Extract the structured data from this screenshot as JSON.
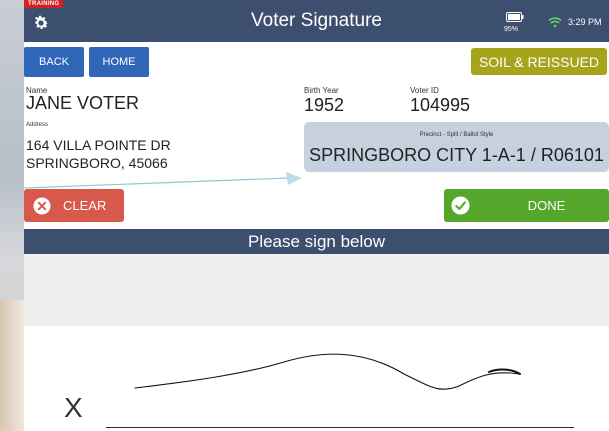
{
  "header": {
    "training_badge": "TRAINING",
    "title": "Voter Signature",
    "battery_percent": "95%",
    "time": "3:29 PM",
    "icons": [
      "gear-icon",
      "battery-icon",
      "wifi-icon"
    ]
  },
  "nav": {
    "back_label": "BACK",
    "home_label": "HOME"
  },
  "status_badge": "SOIL & REISSUED",
  "voter": {
    "name_label": "Name",
    "name": "JANE VOTER",
    "address_label": "Address",
    "address_line1": "164 VILLA POINTE DR",
    "address_line2": "SPRINGBORO, 45066",
    "birth_year_label": "Birth Year",
    "birth_year": "1952",
    "voter_id_label": "Voter ID",
    "voter_id": "104995"
  },
  "precinct": {
    "label": "Precinct - Split / Ballot Style",
    "value": "SPRINGBORO CITY 1-A-1 / R06101"
  },
  "actions": {
    "clear_label": "CLEAR",
    "done_label": "DONE"
  },
  "signature": {
    "prompt": "Please sign below",
    "x_mark": "X"
  },
  "colors": {
    "header_bg": "#3d4f6e",
    "nav_button": "#2f66b8",
    "status_badge": "#a5a51c",
    "precinct_bg": "#c6d0df",
    "clear_button": "#d8584b",
    "done_button": "#55a72b",
    "training_badge": "#d42020"
  }
}
